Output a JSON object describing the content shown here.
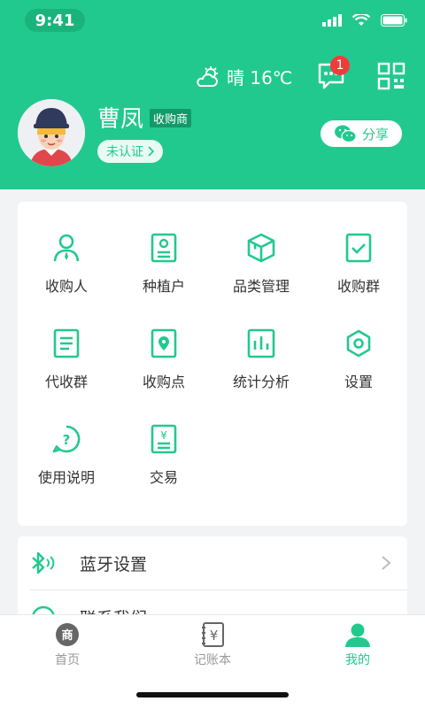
{
  "status_bar": {
    "time": "9:41"
  },
  "header": {
    "weather": "晴 16℃",
    "message_badge": "1",
    "user_name": "曹凤",
    "role_tag": "收购商",
    "cert_status": "未认证",
    "share_label": "分享"
  },
  "grid": [
    {
      "label": "收购人",
      "icon": "person-icon"
    },
    {
      "label": "种植户",
      "icon": "id-card-icon"
    },
    {
      "label": "品类管理",
      "icon": "box-icon"
    },
    {
      "label": "收购群",
      "icon": "check-icon"
    },
    {
      "label": "代收群",
      "icon": "document-icon"
    },
    {
      "label": "收购点",
      "icon": "location-icon"
    },
    {
      "label": "统计分析",
      "icon": "chart-icon"
    },
    {
      "label": "设置",
      "icon": "settings-icon"
    },
    {
      "label": "使用说明",
      "icon": "help-icon"
    },
    {
      "label": "交易",
      "icon": "yuan-doc-icon"
    }
  ],
  "list": [
    {
      "label": "蓝牙设置",
      "icon": "bluetooth-icon"
    },
    {
      "label": "联系我们",
      "icon": "contact-icon"
    }
  ],
  "tabs": [
    {
      "label": "首页",
      "icon": "shop-icon"
    },
    {
      "label": "记账本",
      "icon": "ledger-icon"
    },
    {
      "label": "我的",
      "icon": "profile-icon"
    }
  ],
  "colors": {
    "primary": "#22C98E",
    "badge": "#F03B3B"
  }
}
